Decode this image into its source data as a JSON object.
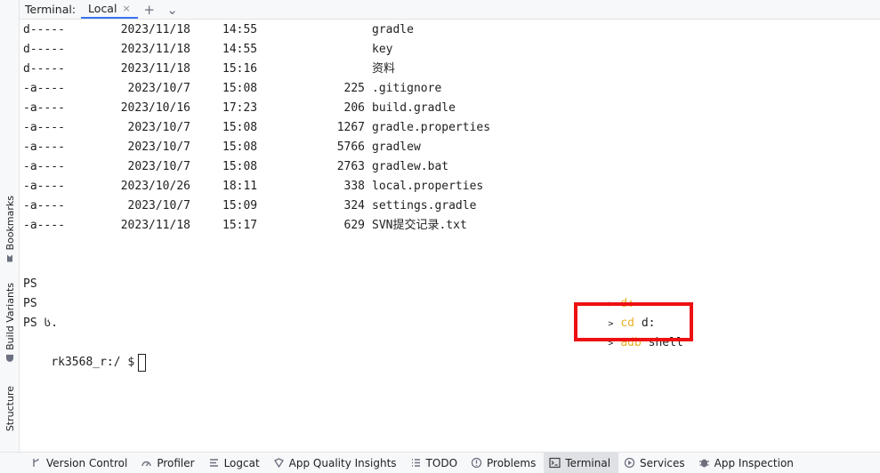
{
  "header": {
    "title": "Terminal:",
    "tab_label": "Local",
    "close_glyph": "×",
    "add_glyph": "+",
    "more_glyph": "⌄"
  },
  "sidebar": {
    "items": [
      {
        "label": "Bookmarks",
        "icon": "bookmark-icon"
      },
      {
        "label": "Build Variants",
        "icon": "android-icon"
      },
      {
        "label": "Structure",
        "icon": "structure-icon"
      }
    ]
  },
  "listing": {
    "rows": [
      {
        "mode": "d-----",
        "date": "2023/11/18",
        "time": "14:55",
        "length": "",
        "name": "gradle"
      },
      {
        "mode": "d-----",
        "date": "2023/11/18",
        "time": "14:55",
        "length": "",
        "name": "key"
      },
      {
        "mode": "d-----",
        "date": "2023/11/18",
        "time": "15:16",
        "length": "",
        "name": "资料"
      },
      {
        "mode": "-a----",
        "date": "2023/10/7",
        "time": "15:08",
        "length": "225",
        "name": ".gitignore"
      },
      {
        "mode": "-a----",
        "date": "2023/10/16",
        "time": "17:23",
        "length": "206",
        "name": "build.gradle"
      },
      {
        "mode": "-a----",
        "date": "2023/10/7",
        "time": "15:08",
        "length": "1267",
        "name": "gradle.properties"
      },
      {
        "mode": "-a----",
        "date": "2023/10/7",
        "time": "15:08",
        "length": "5766",
        "name": "gradlew"
      },
      {
        "mode": "-a----",
        "date": "2023/10/7",
        "time": "15:08",
        "length": "2763",
        "name": "gradlew.bat"
      },
      {
        "mode": "-a----",
        "date": "2023/10/26",
        "time": "18:11",
        "length": "338",
        "name": "local.properties"
      },
      {
        "mode": "-a----",
        "date": "2023/10/7",
        "time": "15:09",
        "length": "324",
        "name": "settings.gradle"
      },
      {
        "mode": "-a----",
        "date": "2023/11/18",
        "time": "15:17",
        "length": "629",
        "name": "SVN提交记录.txt"
      }
    ]
  },
  "prompts": {
    "lines": [
      "PS",
      "PS",
      "PS ს.",
      "rk3568_r:/ $"
    ]
  },
  "commands": {
    "arrow": ">",
    "items": [
      {
        "cmd": "d:",
        "arg": ""
      },
      {
        "cmd": "cd",
        "arg": "d:"
      },
      {
        "cmd": "adb",
        "arg": "shell"
      }
    ]
  },
  "bottom_bar": {
    "items": [
      {
        "label": "Version Control",
        "icon": "version-control-icon"
      },
      {
        "label": "Profiler",
        "icon": "profiler-icon"
      },
      {
        "label": "Logcat",
        "icon": "logcat-icon"
      },
      {
        "label": "App Quality Insights",
        "icon": "app-quality-icon"
      },
      {
        "label": "TODO",
        "icon": "todo-icon"
      },
      {
        "label": "Problems",
        "icon": "problems-icon"
      },
      {
        "label": "Terminal",
        "icon": "terminal-icon"
      },
      {
        "label": "Services",
        "icon": "services-icon"
      },
      {
        "label": "App Inspection",
        "icon": "app-inspection-icon"
      }
    ],
    "active": "Terminal"
  },
  "colors": {
    "command": "#e8b028",
    "highlight": "#ee1111",
    "active_tab_underline": "#3574f0"
  }
}
